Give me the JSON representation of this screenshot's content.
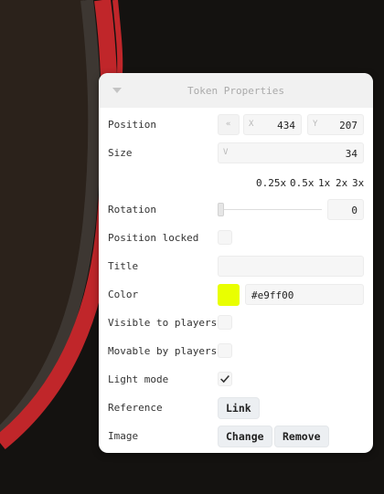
{
  "panel": {
    "title": "Token Properties",
    "collapse_icon": "caret-down-icon"
  },
  "position": {
    "label": "Position",
    "lock_glyph": "«",
    "x_prefix": "X",
    "x_value": "434",
    "y_prefix": "Y",
    "y_value": "207"
  },
  "size": {
    "label": "Size",
    "prefix": "V",
    "value": "34"
  },
  "zoom_options": [
    "0.25x",
    "0.5x",
    "1x",
    "2x",
    "3x"
  ],
  "rotation": {
    "label": "Rotation",
    "value": "0"
  },
  "position_locked": {
    "label": "Position locked",
    "checked": false
  },
  "title_row": {
    "label": "Title",
    "value": ""
  },
  "color": {
    "label": "Color",
    "value": "#e9ff00",
    "swatch": "#e9ff00"
  },
  "visible_to_players": {
    "label": "Visible to players",
    "checked": false
  },
  "movable_by_players": {
    "label": "Movable by players",
    "checked": false
  },
  "light_mode": {
    "label": "Light mode",
    "checked": true,
    "icon": "checkmark-icon"
  },
  "reference": {
    "label": "Reference",
    "button": "Link"
  },
  "image": {
    "label": "Image",
    "change_button": "Change",
    "remove_button": "Remove"
  },
  "colors": {
    "map_red": "#c0262a",
    "background": "#141210"
  }
}
